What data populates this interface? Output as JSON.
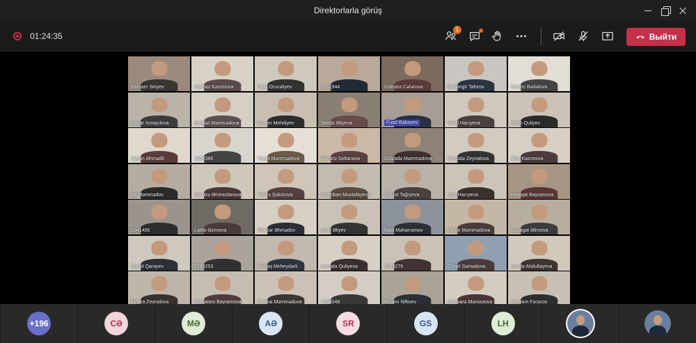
{
  "window": {
    "title": "Direktorlarla görüş"
  },
  "call": {
    "timer": "01:24:35",
    "participants_badge": "1",
    "leave_label": "Выйти"
  },
  "grid": [
    {
      "name": "Bahram Siriyev",
      "bg": "#9a8a7e",
      "shirt": "#3a3530"
    },
    {
      "name": "Solmaz Kazımova",
      "bg": "#d8d2c6",
      "shirt": "#5a4a4a"
    },
    {
      "name": "Safa Orucəliyev",
      "bg": "#cfc8bd",
      "shirt": "#333"
    },
    {
      "name": "1051944",
      "bg": "#b8a99a",
      "shirt": "#222a35"
    },
    {
      "name": "Gülnara Cəfərova",
      "bg": "#7a6b5e",
      "shirt": "#5b3a3a"
    },
    {
      "name": "Cahangir Tahirov",
      "bg": "#c9c6c2",
      "shirt": "#2b3440"
    },
    {
      "name": "Sevinc Bədəlova",
      "bg": "#e2ddd5",
      "shirt": "#444"
    },
    {
      "name": "İntizar İsmayılova",
      "bg": "#b9b3aa",
      "shirt": "#3c3c3c"
    },
    {
      "name": "Saadət Məmmədova",
      "bg": "#d6cfc4",
      "shirt": "#5a5050"
    },
    {
      "name": "Kəram Mehdiyev",
      "bg": "#c8bfb2",
      "shirt": "#2e2e2e"
    },
    {
      "name": "Sevda Əliyeva",
      "bg": "#8a7f73",
      "shirt": "#6a4a4a"
    },
    {
      "name": "Fuad Babayev",
      "bg": "#a79d94",
      "shirt": "#263040",
      "highlight": true
    },
    {
      "name": "Nihal Hacıyeva",
      "bg": "#d1c8be",
      "shirt": "#4a3f3f"
    },
    {
      "name": "Taleh Quliyev",
      "bg": "#cbc3b8",
      "shirt": "#2a2a2a"
    },
    {
      "name": "Aygün Əhmədli",
      "bg": "#e0d8cc",
      "shirt": "#5b3b3b"
    },
    {
      "name": "1054386",
      "bg": "#d9d4cd",
      "shirt": "#444"
    },
    {
      "name": "Yaqut Məmmədova",
      "bg": "#e6dfd6",
      "shirt": "#6a5a4a"
    },
    {
      "name": "Qəmirə Soltanova",
      "bg": "#c9b9a6",
      "shirt": "#5a4040"
    },
    {
      "name": "Gülzadə Məmmədova",
      "bg": "#8d8178",
      "shirt": "#3d3030"
    },
    {
      "name": "Tünzalə Zeynalova",
      "bg": "#d3cbc0",
      "shirt": "#333"
    },
    {
      "name": "Ziba Kazımova",
      "bg": "#d7cfc4",
      "shirt": "#4b3b3b"
    },
    {
      "name": "Əli Məmmədov",
      "bg": "#b5aca2",
      "shirt": "#2b2b2b"
    },
    {
      "name": "Qəmirə Əmiraslanova",
      "bg": "#d0c7bb",
      "shirt": "#4a3838"
    },
    {
      "name": "Tahirə Şükürova",
      "bg": "#cfc5b9",
      "shirt": "#553f3f"
    },
    {
      "name": "Mehriban Mustafayeva",
      "bg": "#c4bbb0",
      "shirt": "#5a4a40"
    },
    {
      "name": "Ziniyət Tağıyeva",
      "bg": "#b9b2a8",
      "shirt": "#4a4040"
    },
    {
      "name": "Jala Hacıyeva",
      "bg": "#cdc4b8",
      "shirt": "#3a3030"
    },
    {
      "name": "Haqiqat Bayramova",
      "bg": "#a89684",
      "shirt": "#5a3535"
    },
    {
      "name": "1041406",
      "bg": "#9a948d",
      "shirt": "#2d2d2d"
    },
    {
      "name": "Latifa Əzimova",
      "bg": "#6f6a64",
      "shirt": "#4a3a3a"
    },
    {
      "name": "Abuzər Əhmədov",
      "bg": "#d6cfc5",
      "shirt": "#2a2f38"
    },
    {
      "name": "Anar Əliyev",
      "bg": "#cac2b6",
      "shirt": "#333"
    },
    {
      "name": "Nabi Məhərrəmov",
      "bg": "#8c939a",
      "shirt": "#2b3038"
    },
    {
      "name": "Bahar Məmmədova",
      "bg": "#c5b7a6",
      "shirt": "#4a3c3c"
    },
    {
      "name": "Sadagat Əlimova",
      "bg": "#b8ae9f",
      "shirt": "#3c3c3c"
    },
    {
      "name": "Qorxit Qarayev",
      "bg": "#cfc8be",
      "shirt": "#2a2f38"
    },
    {
      "name": "2740253",
      "bg": "#aaa49c",
      "shirt": "#303030"
    },
    {
      "name": "Mirfaiq Mirheydərli",
      "bg": "#c1b9ae",
      "shirt": "#2c3440"
    },
    {
      "name": "Kamala Quliyeva",
      "bg": "#d8d0c5",
      "shirt": "#3a2f2f"
    },
    {
      "name": "1049276",
      "bg": "#cbc2b6",
      "shirt": "#433"
    },
    {
      "name": "Günel Səmədova",
      "bg": "#8fa0b3",
      "shirt": "#4a3a3a"
    },
    {
      "name": "Sevda Abdullayeva",
      "bg": "#d2c9bd",
      "shirt": "#3f3333"
    },
    {
      "name": "Elnara Zeynalova",
      "bg": "#bfb6aa",
      "shirt": "#3a3030"
    },
    {
      "name": "Nurgalam Bayramova",
      "bg": "#c6bdb1",
      "shirt": "#4f3d3d"
    },
    {
      "name": "Tarana Məmmədova",
      "bg": "#cbc2b5",
      "shirt": "#3d3434"
    },
    {
      "name": "1048048",
      "bg": "#d3cdc5",
      "shirt": "#383838"
    },
    {
      "name": "Nizami Niftiyev",
      "bg": "#a9a398",
      "shirt": "#2a2e36"
    },
    {
      "name": "Mehparə Mənsurova",
      "bg": "#d4ccc1",
      "shirt": "#4a3535"
    },
    {
      "name": "Xeyyam Fərəcov",
      "bg": "#c8c0b4",
      "shirt": "#2e2e2e"
    }
  ],
  "strip": [
    {
      "kind": "avatar",
      "text": "+196",
      "bg": "#6a6fc8",
      "fg": "#ffffff"
    },
    {
      "kind": "avatar",
      "text": "CƏ",
      "bg": "#f3d6da",
      "fg": "#a3354b"
    },
    {
      "kind": "avatar",
      "text": "MƏ",
      "bg": "#e0ecd6",
      "fg": "#3f6b2a"
    },
    {
      "kind": "avatar",
      "text": "AƏ",
      "bg": "#d9e6f2",
      "fg": "#2f5b8a"
    },
    {
      "kind": "avatar",
      "text": "SR",
      "bg": "#f4dce2",
      "fg": "#a33653"
    },
    {
      "kind": "avatar",
      "text": "GS",
      "bg": "#d7e5f2",
      "fg": "#2f5b8a"
    },
    {
      "kind": "avatar",
      "text": "LH",
      "bg": "#dfecd5",
      "fg": "#3f6b2a"
    },
    {
      "kind": "photo",
      "active": true
    },
    {
      "kind": "photo",
      "active": false
    }
  ]
}
